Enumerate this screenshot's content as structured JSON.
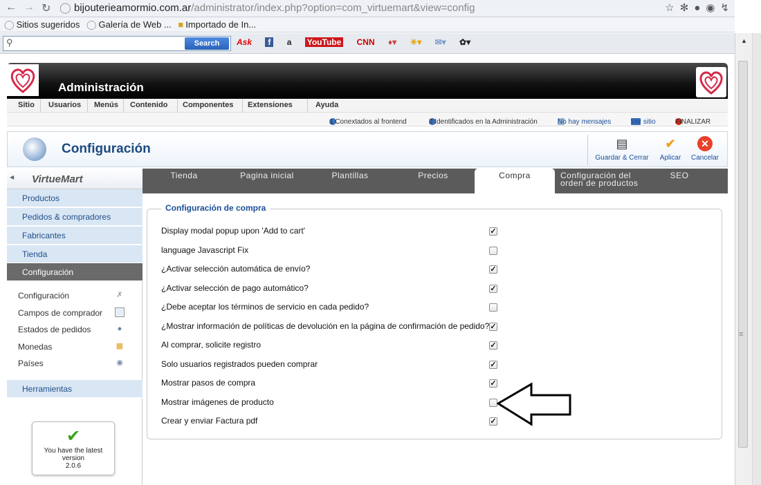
{
  "browser": {
    "url_host": "bijouterieamormio.com.ar",
    "url_path": "/administrator/index.php?option=com_virtuemart&view=config",
    "bookmarks": [
      "Sitios sugeridos",
      "Galería de Web ...",
      "Importado de In..."
    ],
    "search_button": "Search",
    "toolbar_items": [
      "Ask",
      "f",
      "a",
      "YouTube",
      "CNN"
    ]
  },
  "admin": {
    "title": "Administración",
    "menu": [
      "Sitio",
      "Usuarios",
      "Menús",
      "Contenido",
      "Componentes",
      "Extensiones",
      "Ayuda"
    ],
    "status": {
      "frontend": "1 Conextados al frontend",
      "admin": "2 Identificados en la Administración",
      "messages": "No hay mensajes",
      "view_site": "Ver sitio",
      "logout": "FINALIZAR"
    }
  },
  "page": {
    "title": "Configuración",
    "toolbar": {
      "save_close": "Guardar & Cerrar",
      "apply": "Aplicar",
      "cancel": "Cancelar"
    }
  },
  "sidebar": {
    "logo_text": "VirtueMart",
    "sections": [
      "Productos",
      "Pedidos & compradores",
      "Fabricantes",
      "Tienda",
      "Configuración"
    ],
    "active_section": "Configuración",
    "sub_items": [
      "Configuración",
      "Campos de comprador",
      "Estados de pedidos",
      "Monedas",
      "Países"
    ],
    "tools": "Herramientas",
    "version": {
      "line1": "You have the latest",
      "line2": "version",
      "number": "2.0.6"
    }
  },
  "tabs": [
    "Tienda",
    "Pagina inicial",
    "Plantillas",
    "Precios",
    "Compra",
    "Configuración del orden de productos",
    "SEO"
  ],
  "active_tab": "Compra",
  "section_title": "Configuración de compra",
  "options": [
    {
      "label": "Display modal popup upon 'Add to cart'",
      "checked": true
    },
    {
      "label": "language Javascript Fix",
      "checked": false
    },
    {
      "label": "¿Activar selección automática de envío?",
      "checked": true
    },
    {
      "label": "¿Activar selección de pago automático?",
      "checked": true
    },
    {
      "label": "¿Debe aceptar los términos de servicio en cada pedido?",
      "checked": false
    },
    {
      "label": "¿Mostrar información de políticas de devolución en la página de confirmación de pedido?",
      "checked": true
    },
    {
      "label": "Al comprar, solicite registro",
      "checked": true
    },
    {
      "label": "Solo usuarios registrados pueden comprar",
      "checked": true
    },
    {
      "label": "Mostrar pasos de compra",
      "checked": true
    },
    {
      "label": "Mostrar imágenes de producto",
      "checked": false
    },
    {
      "label": "Crear y enviar Factura pdf",
      "checked": true
    }
  ],
  "colors": {
    "accent": "#1a4e99",
    "sidebar_bg": "#d9e6f4",
    "active_bg": "#6a6a6a",
    "tab_bar": "#5b5b5b"
  }
}
